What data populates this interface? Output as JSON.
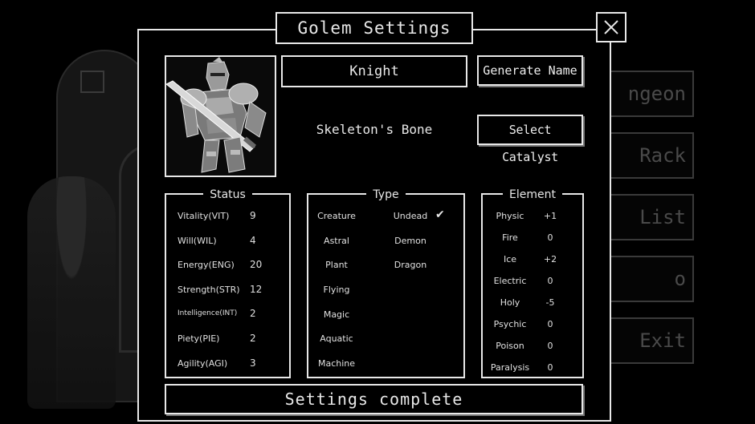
{
  "background_menu": {
    "items": [
      "ngeon",
      "Rack",
      "List",
      "o",
      "Exit"
    ]
  },
  "dialog": {
    "title": "Golem Settings",
    "golem_name": "Knight",
    "generate_name_label": "Generate Name",
    "catalyst": "Skeleton's Bone",
    "select_catalyst_label": "Select Catalyst",
    "complete_label": "Settings complete"
  },
  "status": {
    "title": "Status",
    "rows": [
      {
        "label": "Vitality(VIT)",
        "value": "9"
      },
      {
        "label": "Will(WIL)",
        "value": "4"
      },
      {
        "label": "Energy(ENG)",
        "value": "20"
      },
      {
        "label": "Strength(STR)",
        "value": "12"
      },
      {
        "label": "Intelligence(INT)",
        "value": "2"
      },
      {
        "label": "Piety(PIE)",
        "value": "2"
      },
      {
        "label": "Agility(AGI)",
        "value": "3"
      }
    ]
  },
  "type": {
    "title": "Type",
    "left": [
      "Creature",
      "Astral",
      "Plant",
      "Flying",
      "Magic",
      "Aquatic",
      "Machine"
    ],
    "right": [
      "Undead",
      "Demon",
      "Dragon"
    ],
    "selected": "Undead",
    "check_glyph": "✔"
  },
  "element": {
    "title": "Element",
    "rows": [
      {
        "label": "Physic",
        "value": "+1"
      },
      {
        "label": "Fire",
        "value": "0"
      },
      {
        "label": "Ice",
        "value": "+2"
      },
      {
        "label": "Electric",
        "value": "0"
      },
      {
        "label": "Holy",
        "value": "-5"
      },
      {
        "label": "Psychic",
        "value": "0"
      },
      {
        "label": "Poison",
        "value": "0"
      },
      {
        "label": "Paralysis",
        "value": "0"
      }
    ]
  }
}
